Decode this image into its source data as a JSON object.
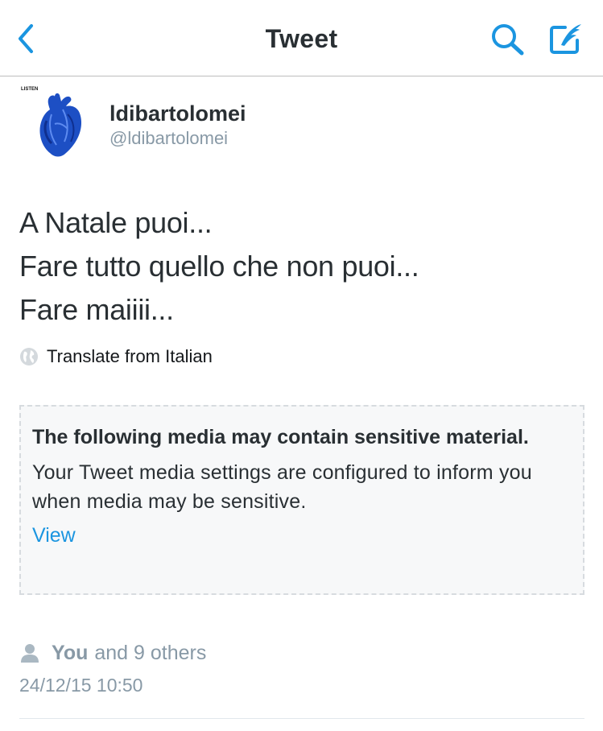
{
  "nav": {
    "title": "Tweet",
    "back_icon": "chevron-left-icon",
    "search_icon": "search-icon",
    "compose_icon": "compose-icon",
    "accent": "#1b95e0"
  },
  "author": {
    "display_name": "ldibartolomei",
    "handle": "@ldibartolomei",
    "avatar_caption": "LISTEN"
  },
  "tweet": {
    "lines": [
      "A Natale puoi...",
      "Fare tutto quello che non puoi...",
      "Fare maiiii..."
    ],
    "translate_label": "Translate from Italian"
  },
  "sensitive_notice": {
    "title": "The following media may contain sensitive material.",
    "description": "Your Tweet media settings are configured to inform you when media may be sensitive.",
    "view_label": "View"
  },
  "engagement": {
    "you_label": "You",
    "others_label": "and 9 others",
    "timestamp": "24/12/15 10:50"
  }
}
